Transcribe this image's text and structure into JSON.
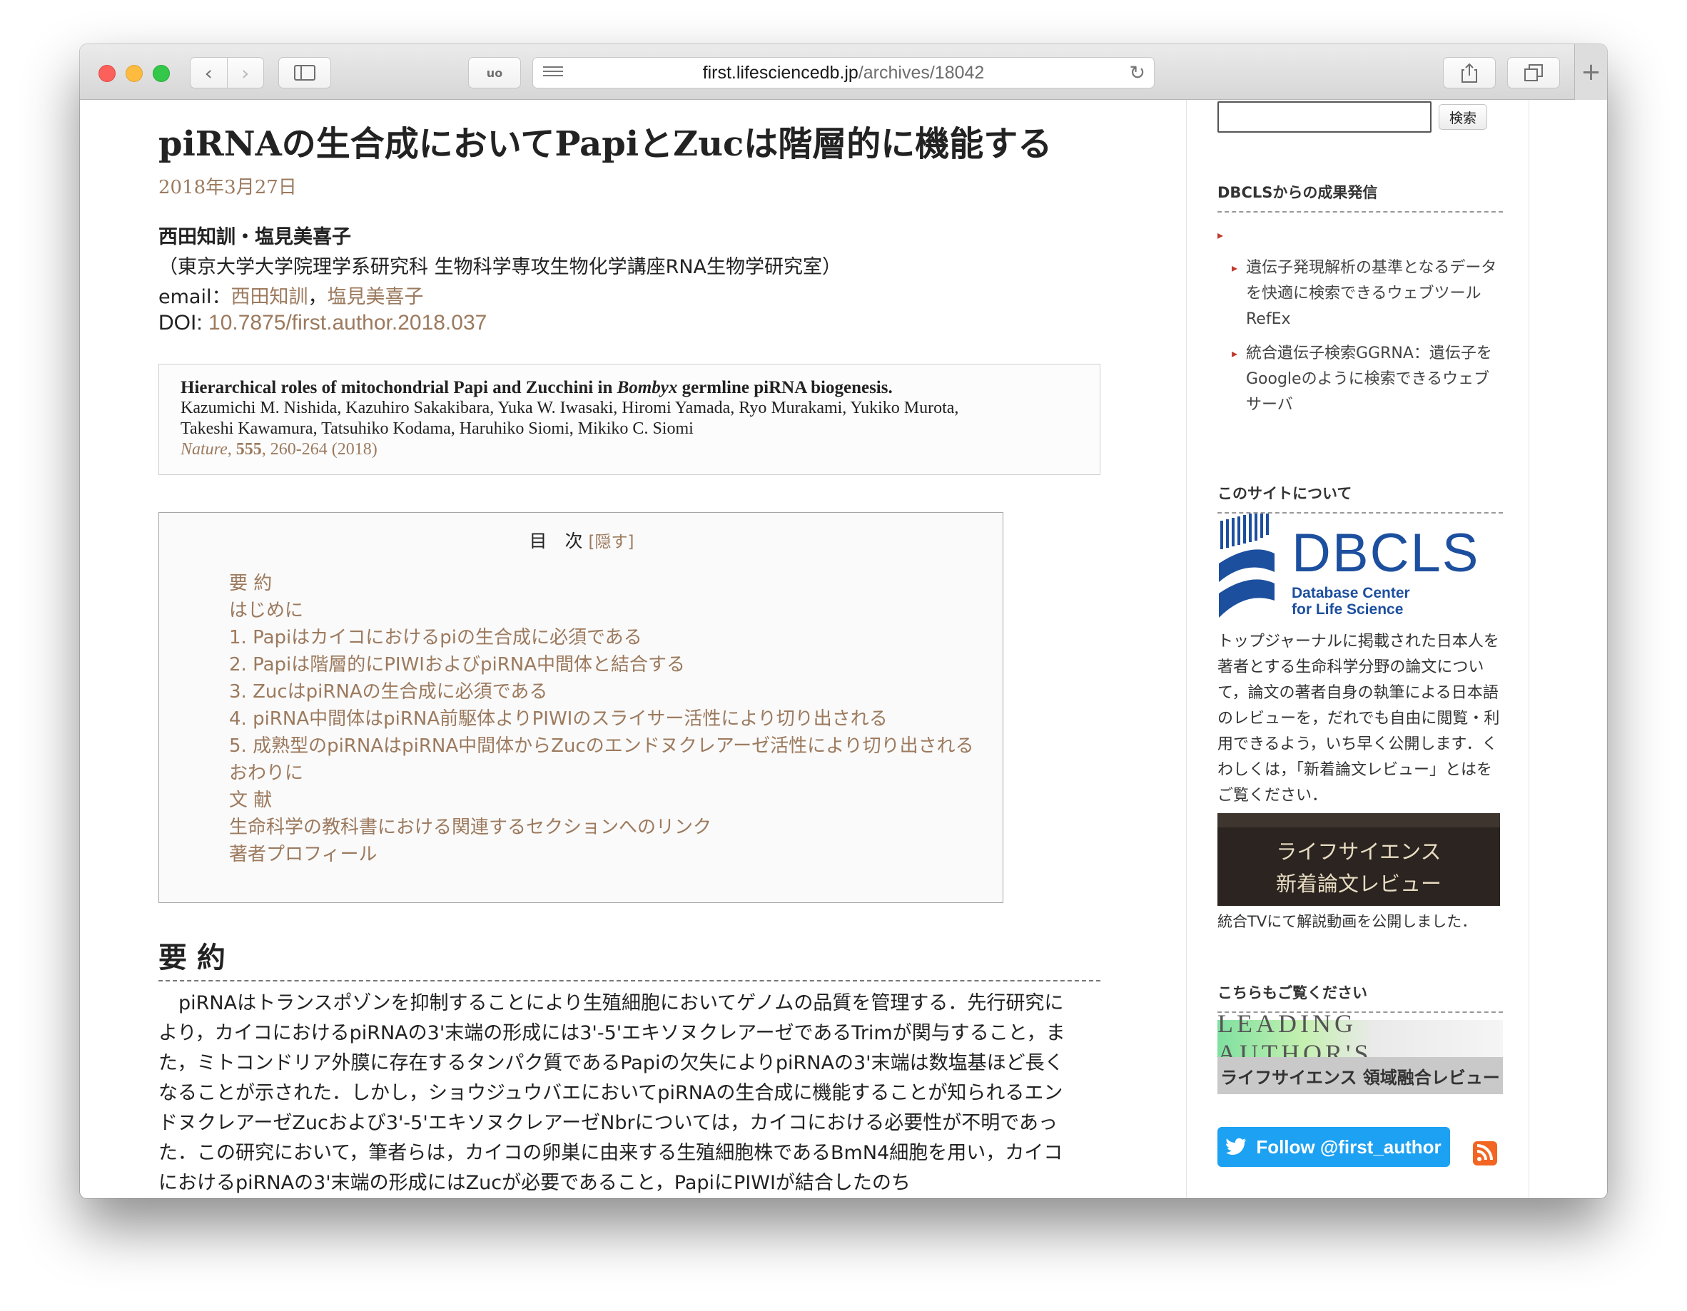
{
  "browser": {
    "url_host": "first.lifesciencedb.jp",
    "url_path": "/archives/18042"
  },
  "article": {
    "title": "piRNAの生合成においてPapiとZucは階層的に機能する",
    "date": "2018年3月27日",
    "authors": "西田知訓・塩見美喜子",
    "affiliation": "（東京大学大学院理学系研究科 生物科学専攻生物化学講座RNA生物学研究室）",
    "email_label": "email：",
    "email_author1": "西田知訓",
    "email_sep": "，",
    "email_author2": "塩見美喜子",
    "doi_label": "DOI: ",
    "doi_value": "10.7875/first.author.2018.037"
  },
  "citation": {
    "title_pre": "Hierarchical roles of mitochondrial Papi and Zucchini in ",
    "title_em": "Bombyx",
    "title_post": " germline piRNA biogenesis.",
    "authors_line1": "Kazumichi M. Nishida, Kazuhiro Sakakibara, Yuka W. Iwasaki, Hiromi Yamada, Ryo Murakami, Yukiko Murota,",
    "authors_line2": "Takeshi Kawamura, Tatsuhiko Kodama, Haruhiko Siomi, Mikiko C. Siomi",
    "journal": "Nature",
    "volume": "555",
    "pages": ", 260-264 (2018)"
  },
  "toc": {
    "heading": "目　次",
    "hide_label": "[隠す]",
    "items": [
      "要 約",
      "はじめに",
      "1.  Papiはカイコにおけるpiの生合成に必須である",
      "2.  Papiは階層的にPIWIおよびpiRNA中間体と結合する",
      "3.  ZucはpiRNAの生合成に必須である",
      "4.  piRNA中間体はpiRNA前駆体よりPIWIのスライサー活性により切り出される",
      "5.  成熟型のpiRNAはpiRNA中間体からZucのエンドヌクレアーゼ活性により切り出される",
      "おわりに",
      "文 献",
      "生命科学の教科書における関連するセクションへのリンク",
      "著者プロフィール"
    ]
  },
  "summary": {
    "heading": "要 約",
    "text": "piRNAはトランスポゾンを抑制することにより生殖細胞においてゲノムの品質を管理する．先行研究により，カイコにおけるpiRNAの3'末端の形成には3'-5'エキソヌクレアーゼであるTrimが関与すること，また，ミトコンドリア外膜に存在するタンパク質であるPapiの欠失によりpiRNAの3'末端は数塩基ほど長くなることが示された．しかし，ショウジュウバエにおいてpiRNAの生合成に機能することが知られるエンドヌクレアーゼZucおよび3'-5'エキソヌクレアーゼNbrについては，カイコにおける必要性が不明であった．この研究において，筆者らは，カイコの卵巣に由来する生殖細胞株であるBmN4細胞を用い，カイコにおけるpiRNAの3'末端の形成にはZucが必要であること，PapiにPIWIが結合したのち"
  },
  "sidebar": {
    "search_button": "検索",
    "section1_title": "DBCLSからの成果発信",
    "links": [
      "遺伝子発現解析の基準となるデータを快適に検索できるウェブツールRefEx",
      "統合遺伝子検索GGRNA：遺伝子をGoogleのように検索できるウェブサーバ"
    ],
    "section2_title": "このサイトについて",
    "logo_text": "DBCLS",
    "logo_sub1": "Database Center",
    "logo_sub2": "for Life Science",
    "about_text": "トップジャーナルに掲載された日本人を著者とする生命科学分野の論文について，論文の著者自身の執筆による日本語のレビューを，だれでも自由に閲覧・利用できるよう，いち早く公開します．くわしくは，「新着論文レビュー」とはをご覧ください．",
    "video_line1": "ライフサイエンス",
    "video_line2": "新着論文レビュー",
    "video_caption": "統合TVにて解説動画を公開しました．",
    "section3_title": "こちらもご覧ください",
    "banner_top": "LEADING AUTHOR'S",
    "banner_bottom": "ライフサイエンス 領域融合レビュー",
    "follow_label": "Follow @first_author"
  }
}
